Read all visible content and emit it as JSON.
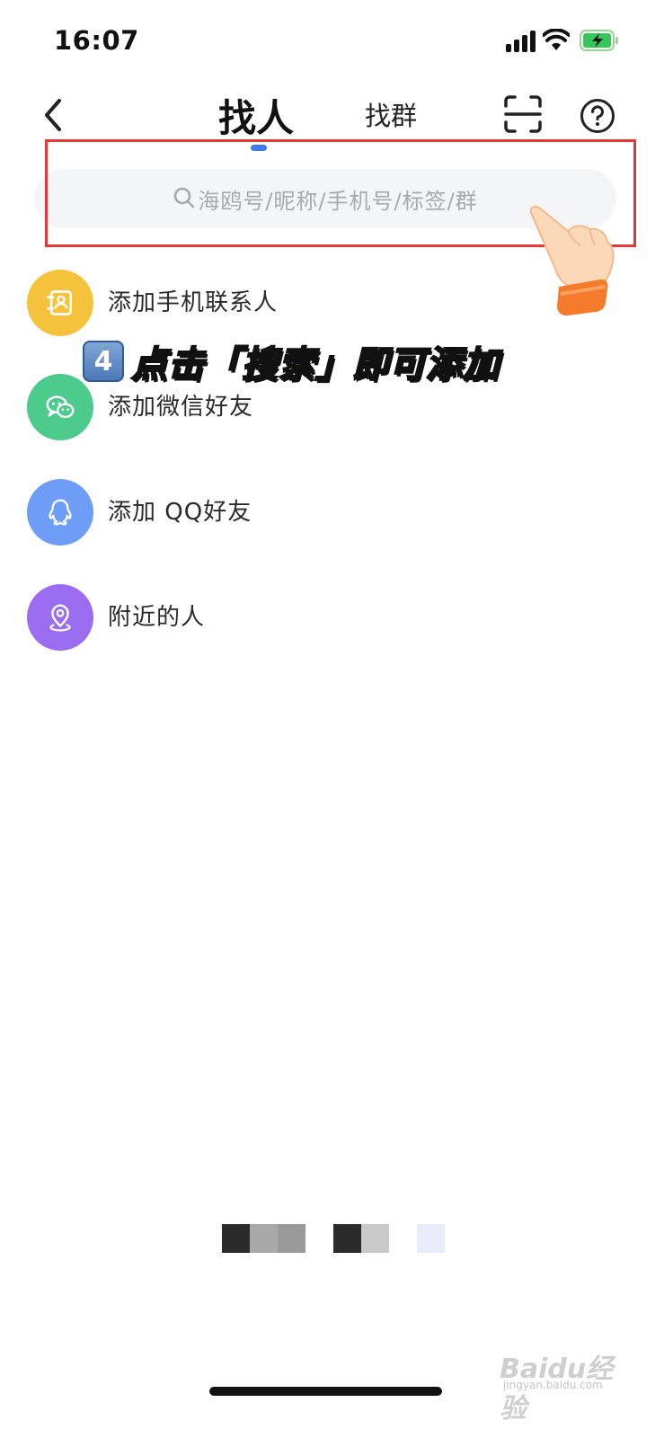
{
  "status_bar": {
    "time": "16:07"
  },
  "nav": {
    "tabs": [
      {
        "label": "找人",
        "active": true
      },
      {
        "label": "找群",
        "active": false
      }
    ],
    "icons": [
      "back-arrow-icon",
      "scan-icon",
      "help-icon"
    ]
  },
  "search": {
    "placeholder": "海鸥号/昵称/手机号/标签/群"
  },
  "list": [
    {
      "label": "添加手机联系人",
      "icon": "contacts-icon",
      "color": "#f5c33b"
    },
    {
      "label": "添加微信好友",
      "icon": "wechat-icon",
      "color": "#4ccb8c"
    },
    {
      "label": "添加 QQ好友",
      "icon": "qq-icon",
      "color": "#6e9df7"
    },
    {
      "label": "附近的人",
      "icon": "location-icon",
      "color": "#9b6cf0"
    }
  ],
  "overlay": {
    "badge": "4",
    "caption": "点击「搜索」即可添加"
  },
  "watermark": {
    "main": "Baidu经验",
    "sub": "jingyan.baidu.com"
  },
  "colors": {
    "accent": "#3d7cf0",
    "highlight": "#e53935",
    "caption": "#ffe33a"
  }
}
